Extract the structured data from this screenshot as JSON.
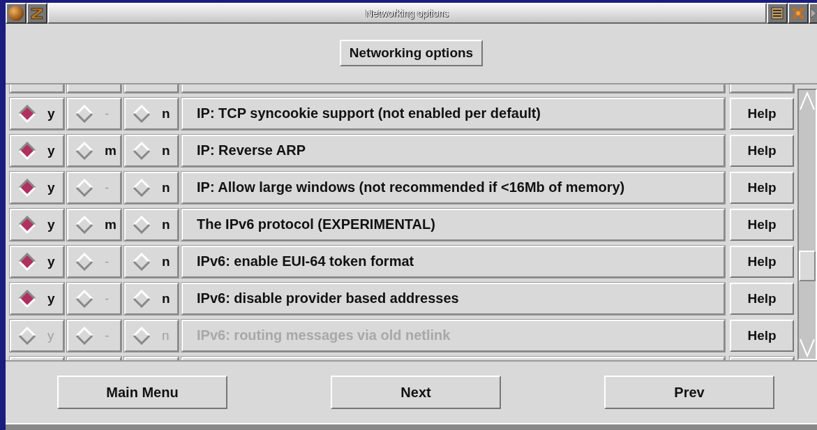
{
  "window": {
    "title": "Networking options"
  },
  "header_button": "Networking options",
  "rows": [
    {
      "label": "IP: TCP syncookie support (not enabled per default)",
      "disabled": false,
      "choices": [
        {
          "label": "y",
          "selected": true
        },
        {
          "label": "-",
          "selected": false
        },
        {
          "label": "n",
          "selected": false
        }
      ],
      "help": "Help"
    },
    {
      "label": "IP: Reverse ARP",
      "disabled": false,
      "choices": [
        {
          "label": "y",
          "selected": true
        },
        {
          "label": "m",
          "selected": false
        },
        {
          "label": "n",
          "selected": false
        }
      ],
      "help": "Help"
    },
    {
      "label": "IP: Allow large windows (not recommended if <16Mb of memory)",
      "disabled": false,
      "choices": [
        {
          "label": "y",
          "selected": true
        },
        {
          "label": "-",
          "selected": false
        },
        {
          "label": "n",
          "selected": false
        }
      ],
      "help": "Help"
    },
    {
      "label": "The IPv6 protocol (EXPERIMENTAL)",
      "disabled": false,
      "choices": [
        {
          "label": "y",
          "selected": true
        },
        {
          "label": "m",
          "selected": false
        },
        {
          "label": "n",
          "selected": false
        }
      ],
      "help": "Help"
    },
    {
      "label": "IPv6: enable EUI-64 token format",
      "disabled": false,
      "choices": [
        {
          "label": "y",
          "selected": true
        },
        {
          "label": "-",
          "selected": false
        },
        {
          "label": "n",
          "selected": false
        }
      ],
      "help": "Help"
    },
    {
      "label": "IPv6: disable provider based addresses",
      "disabled": false,
      "choices": [
        {
          "label": "y",
          "selected": true
        },
        {
          "label": "-",
          "selected": false
        },
        {
          "label": "n",
          "selected": false
        }
      ],
      "help": "Help"
    },
    {
      "label": "IPv6: routing messages via old netlink",
      "disabled": true,
      "choices": [
        {
          "label": "y",
          "selected": false
        },
        {
          "label": "-",
          "selected": false
        },
        {
          "label": "n",
          "selected": false
        }
      ],
      "help": "Help"
    }
  ],
  "footer_buttons": [
    "Main Menu",
    "Next",
    "Prev"
  ]
}
